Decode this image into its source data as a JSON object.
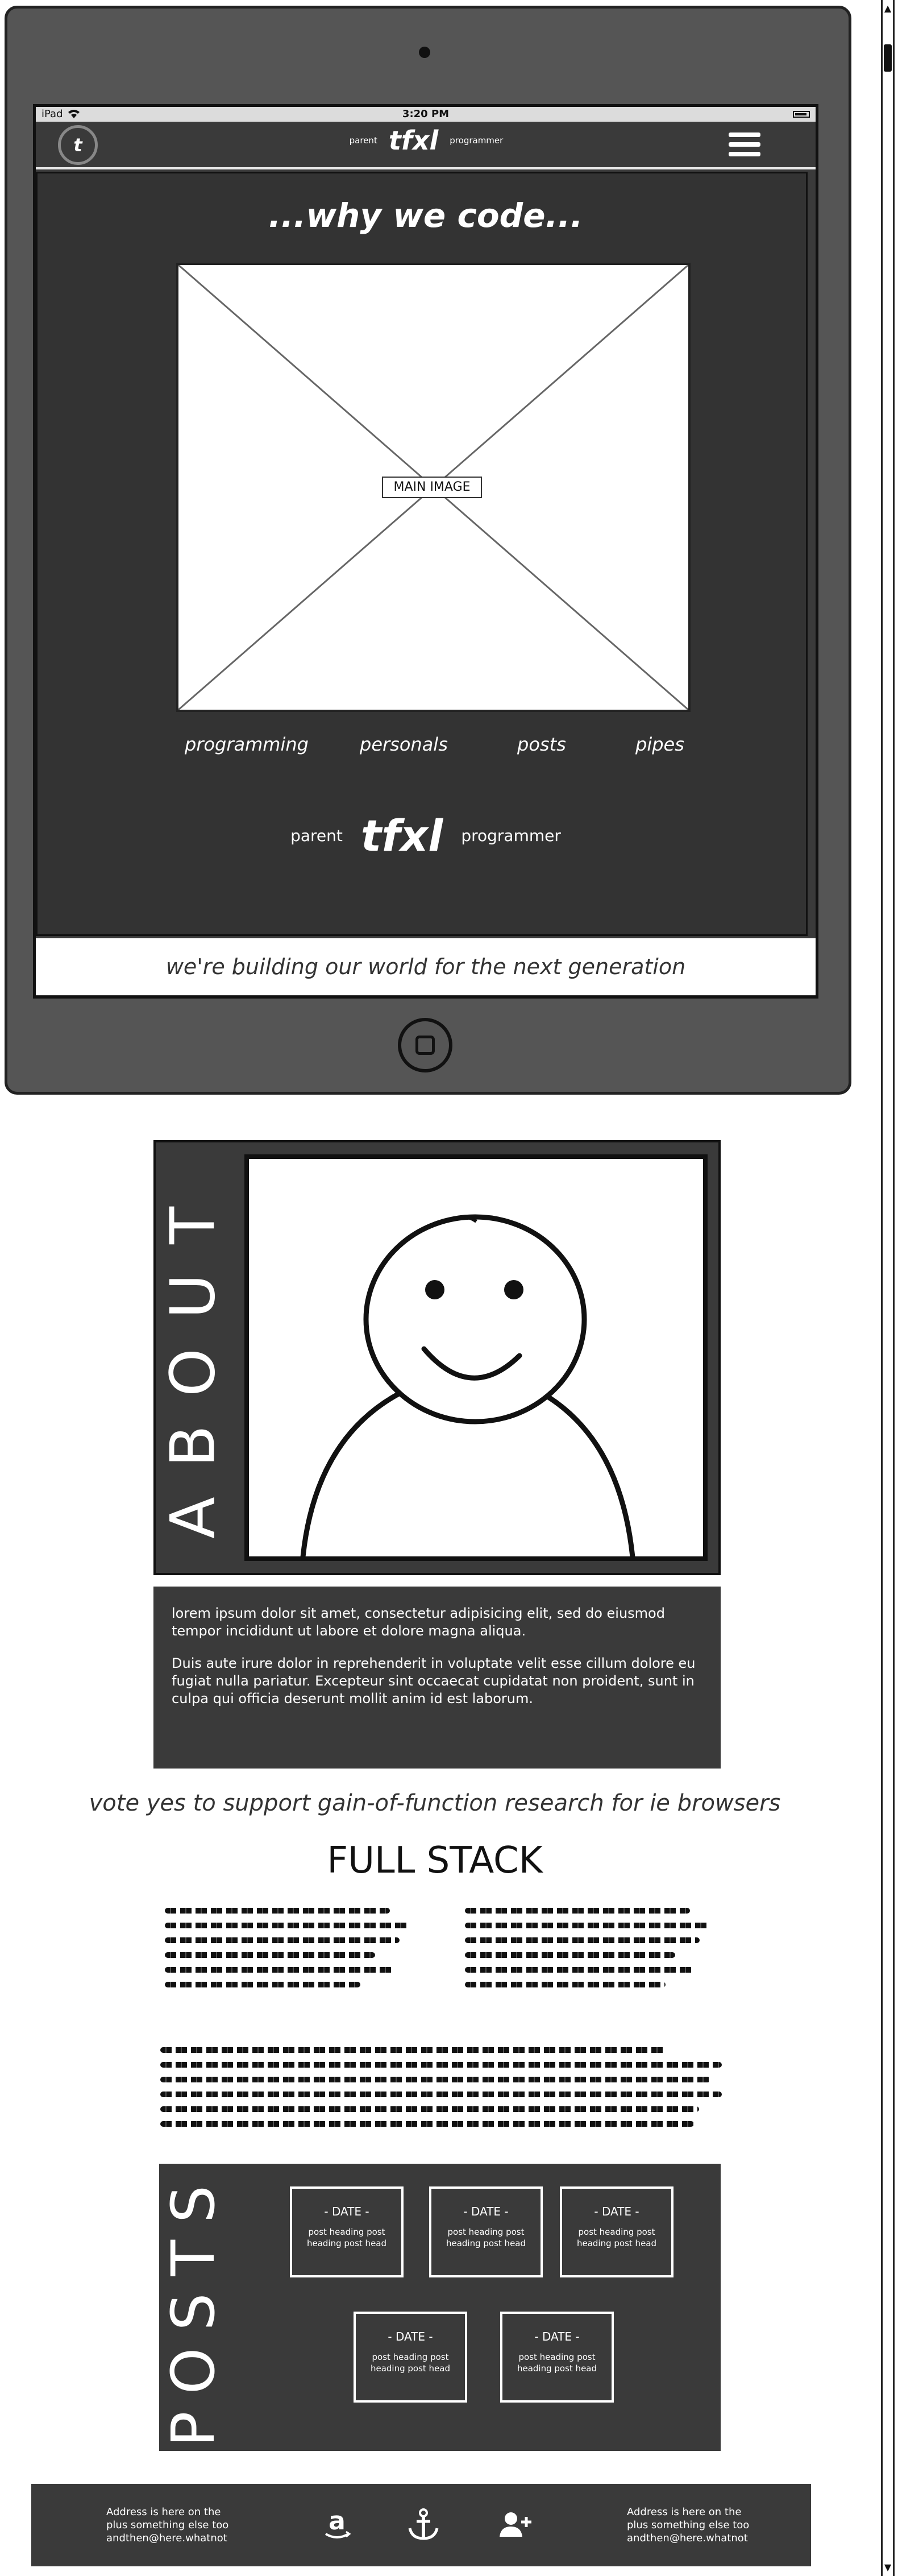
{
  "status_bar": {
    "carrier": "iPad",
    "time": "3:20 PM"
  },
  "nav": {
    "logo_letter": "t",
    "brand_left": "parent",
    "brand_main": "tfxl",
    "brand_right": "programmer"
  },
  "hero": {
    "title": "...why we code...",
    "image_label": "MAIN IMAGE",
    "links": [
      "programming",
      "personals",
      "posts",
      "pipes"
    ],
    "brand_left": "parent",
    "brand_main": "tfxl",
    "brand_right": "programmer",
    "tagline": "we're building our world for the next generation"
  },
  "about": {
    "title": "ABOUT",
    "paragraphs": [
      "lorem ipsum dolor sit amet, consectetur adipisicing elit, sed do eiusmod tempor incididunt ut labore et dolore magna aliqua.",
      "Duis aute irure dolor in reprehenderit in voluptate velit esse cillum dolore eu fugiat nulla pariatur. Excepteur sint occaecat cupidatat non proident, sunt in culpa qui officia deserunt mollit anim id est laborum."
    ]
  },
  "vote_line": "vote yes to support gain-of-function research for ie browsers",
  "fullstack": {
    "title": "FULL STACK"
  },
  "posts": {
    "title": "POSTS",
    "items": [
      {
        "date": "- DATE -",
        "heading": "post heading post heading post head"
      },
      {
        "date": "- DATE -",
        "heading": "post heading post heading post head"
      },
      {
        "date": "- DATE -",
        "heading": "post heading post heading post head"
      },
      {
        "date": "- DATE -",
        "heading": "post heading post heading post head"
      },
      {
        "date": "- DATE -",
        "heading": "post heading post heading post head"
      }
    ]
  },
  "footer": {
    "address_left": [
      "Address is here on the",
      "plus something else too",
      "andthen@here.whatnot"
    ],
    "address_right": [
      "Address is here on the",
      "plus something else too",
      "andthen@here.whatnot"
    ],
    "icons": [
      "amazon-icon",
      "anchor-icon",
      "add-user-icon"
    ]
  }
}
